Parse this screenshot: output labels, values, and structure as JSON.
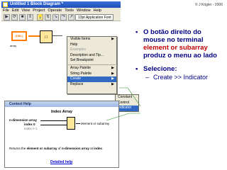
{
  "copyright": "© J Kögler - 2006",
  "window": {
    "title": "Untitled 1 Block Diagram *",
    "menus": [
      "File",
      "Edit",
      "View",
      "Project",
      "Operate",
      "Tools",
      "Window",
      "Help"
    ],
    "font_select": "13pt Application Font"
  },
  "diagram": {
    "array_terminal_text": "[DBL]",
    "array_terminal_label": "array",
    "index_node_text": "[ ]"
  },
  "context_menu": {
    "items": [
      {
        "label": "Visible Items",
        "arrow": true,
        "disabled": false
      },
      {
        "label": "Help",
        "arrow": false,
        "disabled": false
      },
      {
        "label": "Examples",
        "arrow": false,
        "disabled": true
      },
      {
        "label": "Description and Tip...",
        "arrow": false,
        "disabled": false
      },
      {
        "label": "Set Breakpoint",
        "arrow": false,
        "disabled": false
      },
      {
        "label": "Array Palette",
        "arrow": true,
        "disabled": false
      },
      {
        "label": "String Palette",
        "arrow": true,
        "disabled": false
      },
      {
        "label": "Create",
        "arrow": true,
        "disabled": false,
        "highlight": true
      },
      {
        "label": "Replace",
        "arrow": true,
        "disabled": false
      }
    ],
    "submenu": [
      {
        "label": "Constant"
      },
      {
        "label": "Control"
      },
      {
        "label": "Indicator",
        "highlight": true
      }
    ]
  },
  "context_help": {
    "title": "Context Help",
    "function_name": "Index Array",
    "inputs": {
      "n_dimension_array": "n-dimension array",
      "index_0": "index 0",
      "index_n1": "index n-1"
    },
    "output": "element or subarray",
    "description_pre": "Returns the ",
    "description_b1": "element or subarray",
    "description_mid": " of ",
    "description_b2": "n-dimension array",
    "description_post": " at ",
    "description_b3": "index",
    "description_end": ".",
    "link": "Detailed help"
  },
  "bullets": {
    "b1_pre": "O botão direito do mouse no terminal ",
    "b1_red": "element or subarray",
    "b1_post": " produz o menu ao lado",
    "b2": "Selecione:",
    "sub": "Create >> Indicator"
  },
  "colors": {
    "accent_orange": "#ff7a00",
    "bullet_blue": "#000080",
    "highlight_red": "#c00000",
    "menu_highlight": "#316ac5"
  }
}
